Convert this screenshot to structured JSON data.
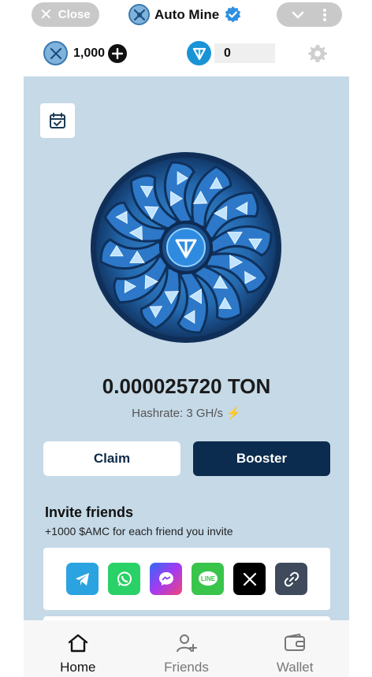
{
  "header": {
    "close_label": "Close",
    "app_title": "Auto Mine",
    "logo_text": "AMC"
  },
  "balances": {
    "amc_value": "1,000",
    "ton_value": "0"
  },
  "main": {
    "ton_amount": "0.000025720 TON",
    "hashrate": "Hashrate: 3 GH/s",
    "claim_label": "Claim",
    "booster_label": "Booster",
    "invite_title": "Invite friends",
    "invite_subtitle": "+1000 $AMC for each friend you invite",
    "share_targets": [
      "telegram",
      "whatsapp",
      "messenger",
      "line",
      "x",
      "copy-link"
    ]
  },
  "nav": {
    "home": "Home",
    "friends": "Friends",
    "wallet": "Wallet"
  },
  "colors": {
    "accent": "#0b2c4e",
    "panel": "#c5d9e7",
    "ton_blue": "#1a93d6",
    "verified": "#2f8fe0"
  }
}
